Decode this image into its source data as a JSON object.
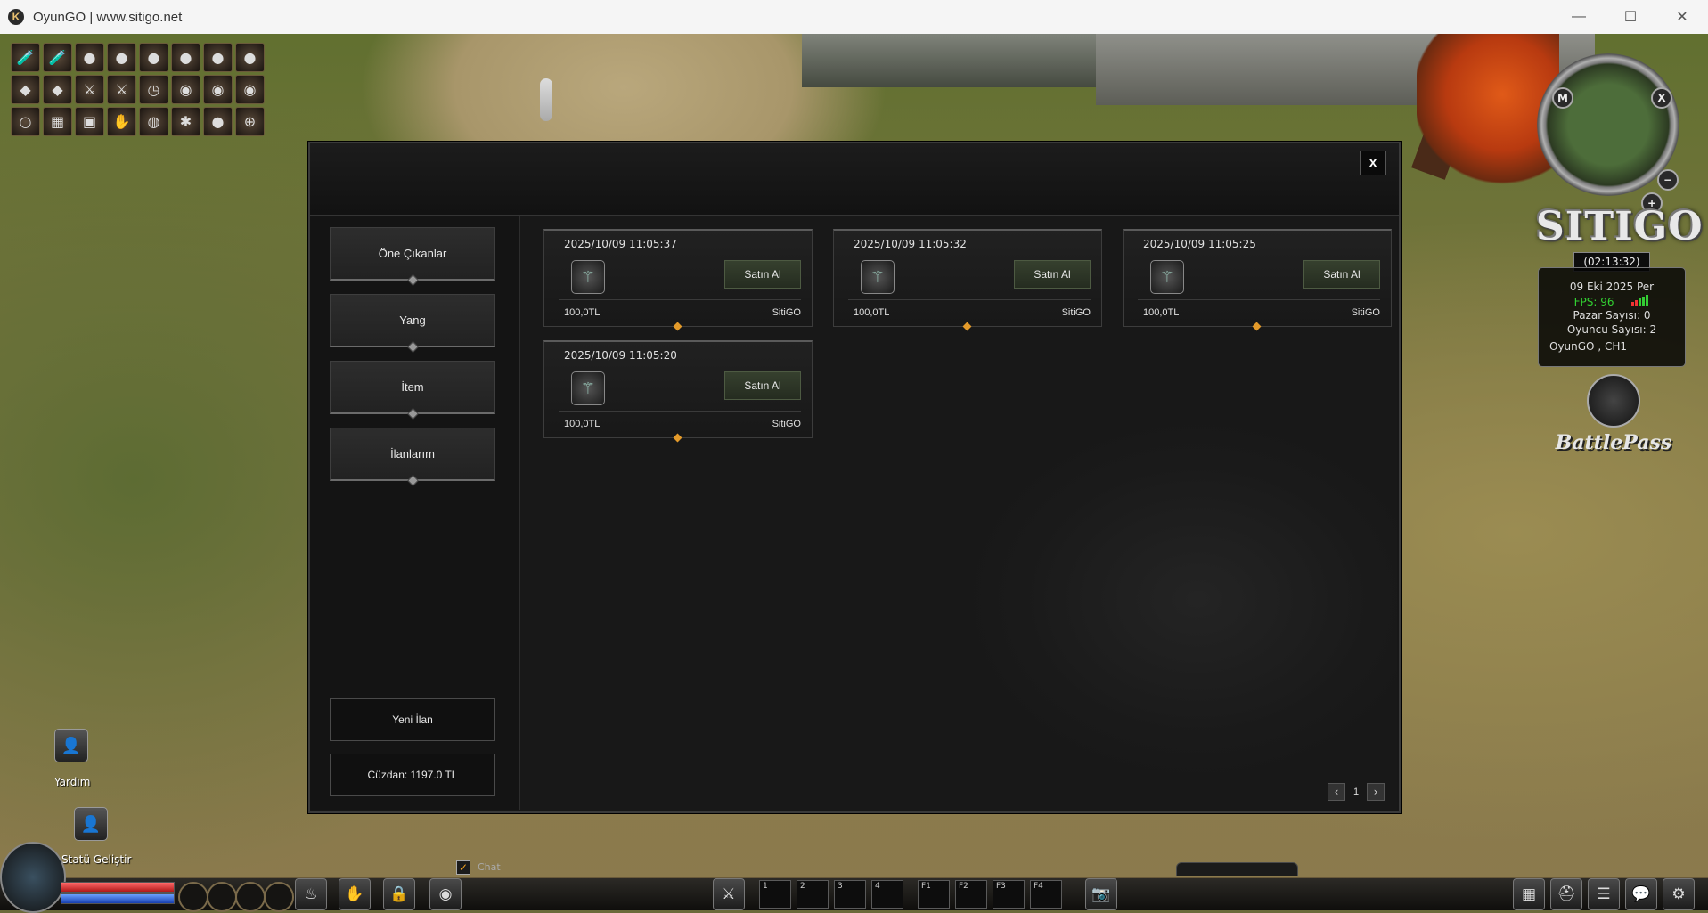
{
  "window": {
    "title": "OyunGO | www.sitigo.net",
    "app_icon_glyph": "K",
    "minimize_glyph": "—",
    "maximize_glyph": "☐",
    "close_glyph": "✕"
  },
  "top_icons": [
    {
      "name": "potion-red-icon",
      "glyph": "🧪"
    },
    {
      "name": "potion-blue-icon",
      "glyph": "🧪"
    },
    {
      "name": "red-potion-icon",
      "glyph": "●"
    },
    {
      "name": "orange-potion-icon",
      "glyph": "●"
    },
    {
      "name": "yellow-potion-icon",
      "glyph": "●"
    },
    {
      "name": "green-potion-icon",
      "glyph": "●"
    },
    {
      "name": "blue-potion-icon",
      "glyph": "●"
    },
    {
      "name": "white-potion-icon",
      "glyph": "●"
    },
    {
      "name": "green-flask-icon",
      "glyph": "◆"
    },
    {
      "name": "pink-flask-icon",
      "glyph": "◆"
    },
    {
      "name": "sword-icon",
      "glyph": "⚔"
    },
    {
      "name": "spear-icon",
      "glyph": "⚔"
    },
    {
      "name": "clock-icon",
      "glyph": "◷"
    },
    {
      "name": "compass-icon",
      "glyph": "◉"
    },
    {
      "name": "bag-icon",
      "glyph": "◉"
    },
    {
      "name": "stone-icon",
      "glyph": "◉"
    },
    {
      "name": "ring-icon",
      "glyph": "○"
    },
    {
      "name": "armor-icon",
      "glyph": "▦"
    },
    {
      "name": "chest-icon",
      "glyph": "▣"
    },
    {
      "name": "hand-icon",
      "glyph": "✋"
    },
    {
      "name": "orb-icon",
      "glyph": "◍"
    },
    {
      "name": "bug-icon",
      "glyph": "✱"
    },
    {
      "name": "coin-icon",
      "glyph": "●"
    },
    {
      "name": "target-icon",
      "glyph": "⊕"
    }
  ],
  "minimap": {
    "m_label": "M",
    "x_label": "X",
    "minus_label": "−",
    "plus_label": "+"
  },
  "server": {
    "logo": "SITIGO",
    "clock": "(02:13:32)",
    "date": "09 Eki 2025 Per",
    "fps": "FPS: 96",
    "market_count": "Pazar Sayısı: 0",
    "player_count": "Oyuncu Sayısı: 2",
    "channel": "OyunGO , CH1"
  },
  "battlepass_label": "BattlePass",
  "side_buttons": {
    "help": {
      "label": "Yardım",
      "glyph": "👤"
    },
    "stat": {
      "label": "Statü Geliştir",
      "glyph": "👤"
    }
  },
  "modal": {
    "close_label": "x",
    "nav": [
      {
        "label": "Öne Çıkanlar"
      },
      {
        "label": "Yang"
      },
      {
        "label": "İtem"
      },
      {
        "label": "İlanlarım"
      }
    ],
    "new_listing_label": "Yeni İlan",
    "wallet_label": "Cüzdan: 1197.0 TL",
    "listings": [
      {
        "date": "2025/10/09 11:05:37",
        "buy_label": "Satın Al",
        "price": "100,0TL",
        "seller": "SitiGO",
        "icon": "spear-icon",
        "glyph": "⚚"
      },
      {
        "date": "2025/10/09 11:05:32",
        "buy_label": "Satın Al",
        "price": "100,0TL",
        "seller": "SitiGO",
        "icon": "spear-icon",
        "glyph": "⚚"
      },
      {
        "date": "2025/10/09 11:05:25",
        "buy_label": "Satın Al",
        "price": "100,0TL",
        "seller": "SitiGO",
        "icon": "spear-icon",
        "glyph": "⚚"
      },
      {
        "date": "2025/10/09 11:05:20",
        "buy_label": "Satın Al",
        "price": "100,0TL",
        "seller": "SitiGO",
        "icon": "spear-icon",
        "glyph": "⚚"
      }
    ],
    "pager": {
      "prev": "‹",
      "page": "1",
      "next": "›"
    }
  },
  "hud": {
    "chat_label": "Chat",
    "chat_checked_glyph": "✓",
    "quick_slots": [
      "1",
      "2",
      "3",
      "4",
      "F1",
      "F2",
      "F3",
      "F4"
    ]
  }
}
